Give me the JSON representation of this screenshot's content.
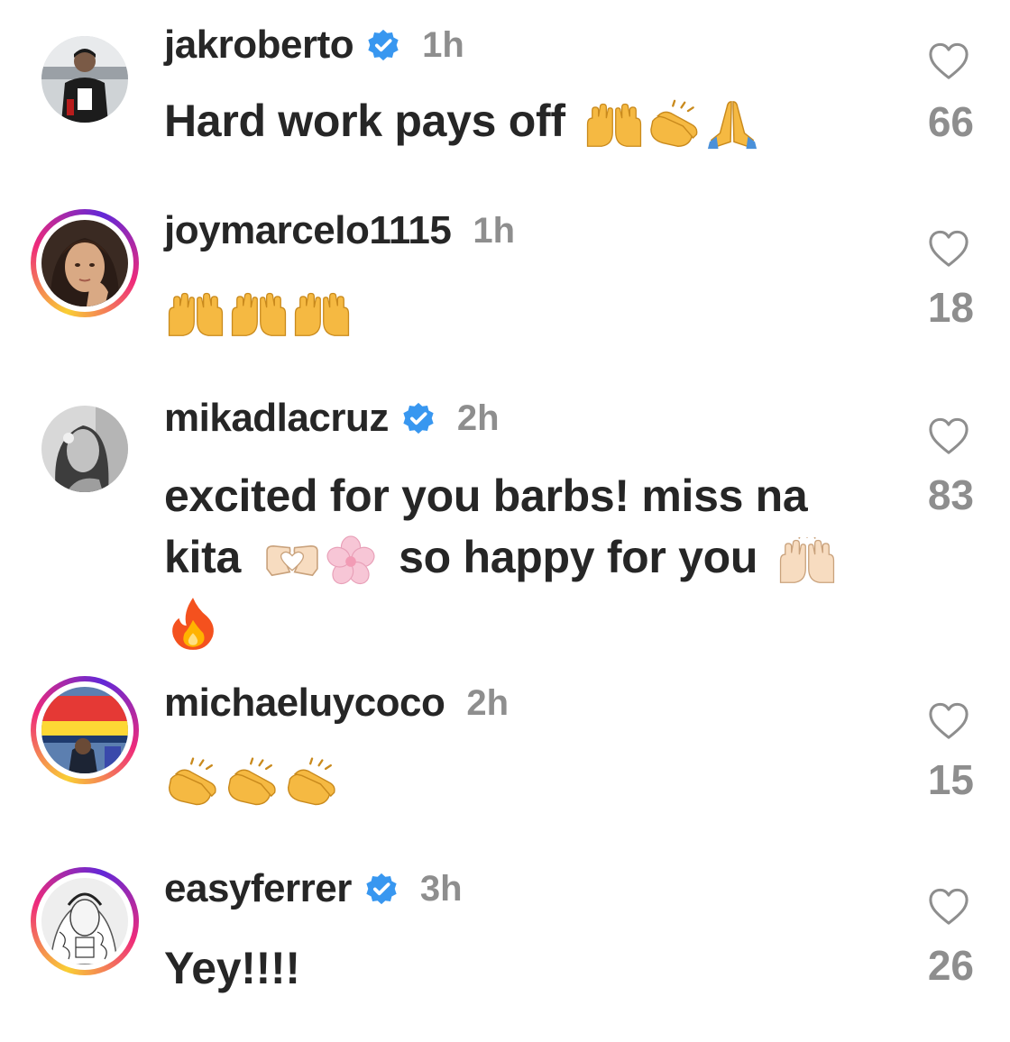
{
  "comments": [
    {
      "username": "jakroberto",
      "verified": true,
      "time": "1h",
      "text": "Hard work pays off",
      "emojis": [
        "raising-hands",
        "clapping-hands",
        "folded-hands"
      ],
      "likes": "66",
      "avatar_ring": false
    },
    {
      "username": "joymarcelo1115",
      "verified": false,
      "time": "1h",
      "text": "",
      "emojis": [
        "raising-hands",
        "raising-hands",
        "raising-hands"
      ],
      "likes": "18",
      "avatar_ring": true
    },
    {
      "username": "mikadlacruz",
      "verified": true,
      "time": "2h",
      "text_line1": "excited for you barbs! miss na",
      "text_line2_a": "kita",
      "text_line2_b": "so happy for you",
      "emojis": [
        "heart-hands",
        "cherry-blossom",
        "raising-hands-light",
        "fire"
      ],
      "likes": "83",
      "avatar_ring": false
    },
    {
      "username": "michaeluycoco",
      "verified": false,
      "time": "2h",
      "text": "",
      "emojis": [
        "clapping-hands",
        "clapping-hands",
        "clapping-hands"
      ],
      "likes": "15",
      "avatar_ring": true
    },
    {
      "username": "easyferrer",
      "verified": true,
      "time": "3h",
      "text": "Yey!!!!",
      "emojis": [],
      "likes": "26",
      "avatar_ring": true
    }
  ],
  "icons": {
    "like": "heart-outline-icon",
    "verified": "verified-badge-icon"
  },
  "colors": {
    "verified_blue": "#3897f0",
    "muted_gray": "#8e8e8e",
    "text": "#262626"
  }
}
